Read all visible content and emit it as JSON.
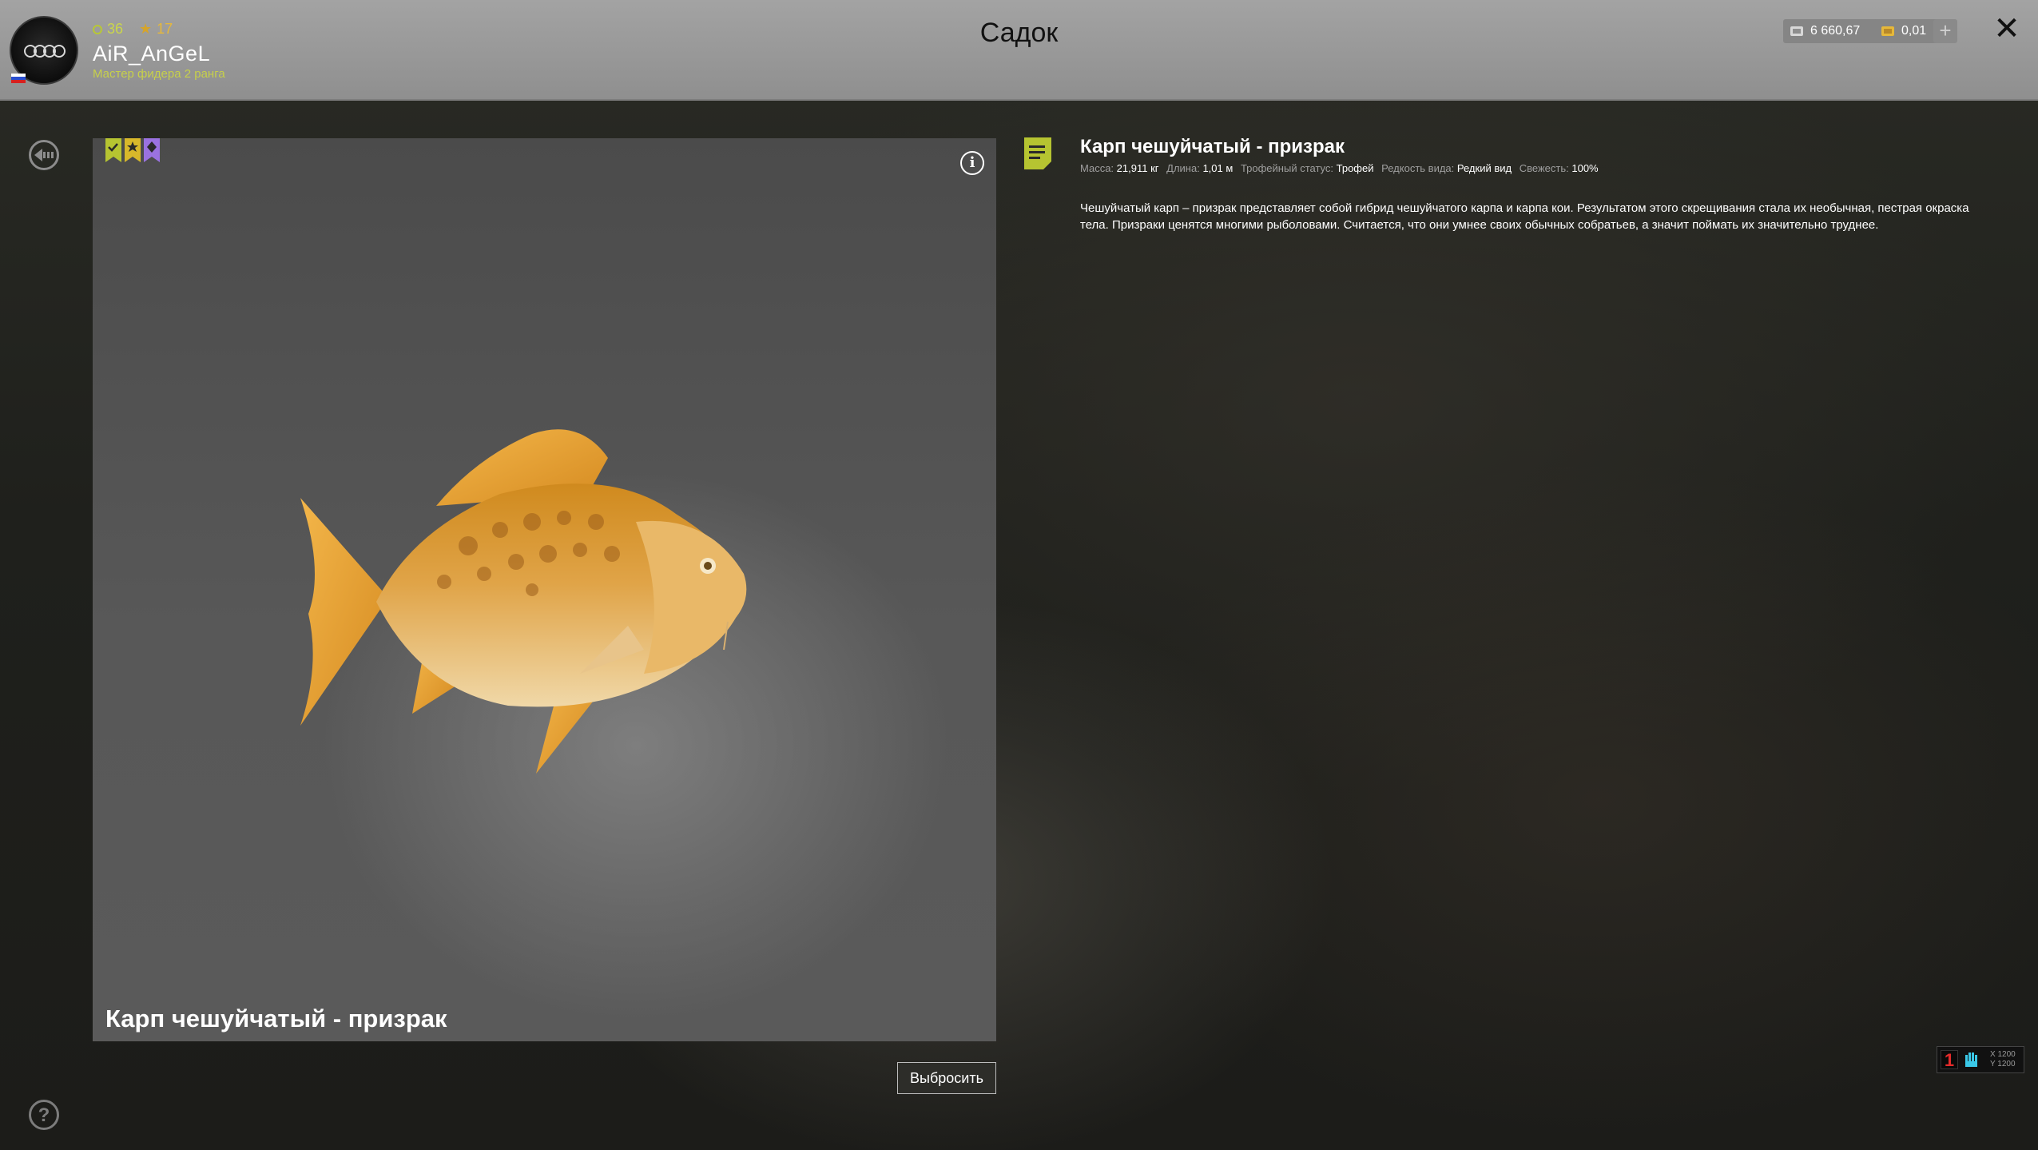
{
  "header": {
    "title": "Садок",
    "user": {
      "level": "36",
      "stars": "17",
      "name": "AiR_AnGeL",
      "rank": "Мастер фидера 2 ранга"
    },
    "currency": {
      "silver": "6 660,67",
      "gold": "0,01"
    },
    "add_label": "+",
    "close_label": "✕"
  },
  "fish": {
    "name": "Карп чешуйчатый - призрак",
    "caption": "Карп чешуйчатый - призрак",
    "info_label": "i",
    "throw_label": "Выбросить",
    "meta": {
      "mass_label": "Масса:",
      "mass": "21,911 кг",
      "length_label": "Длина:",
      "length": "1,01 м",
      "trophy_label": "Трофейный статус:",
      "trophy": "Трофей",
      "rarity_label": "Редкость вида:",
      "rarity": "Редкий вид",
      "freshness_label": "Свежесть:",
      "freshness": "100%"
    },
    "description": "Чешуйчатый карп – призрак представляет собой гибрид чешуйчатого карпа и карпа кои. Результатом этого скрещивания стала их необычная, пестрая окраска тела. Призраки ценятся многими рыболовами. Считается, что они умнее своих обычных собратьев, а значит поймать их значительно труднее.",
    "badges": [
      "check-ribbon-icon",
      "star-ribbon-icon",
      "rare-ribbon-icon"
    ],
    "badge_colors": [
      "#b6c431",
      "#d8b82a",
      "#9a72e0"
    ]
  },
  "help_label": "?",
  "hud": {
    "number": "1",
    "x_label": "X 1200",
    "y_label": "Y 1200"
  },
  "colors": {
    "accent": "#c7d04a",
    "header_bg": "#999999"
  }
}
